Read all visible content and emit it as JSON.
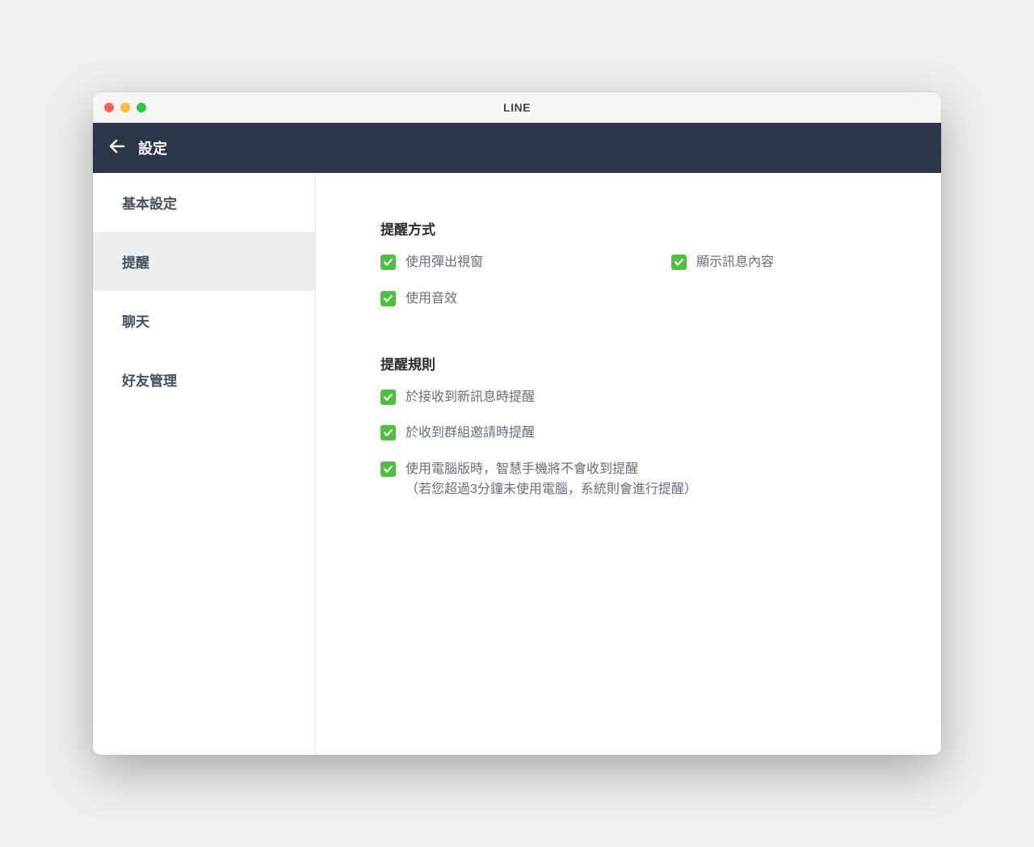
{
  "window": {
    "title": "LINE"
  },
  "header": {
    "title": "設定"
  },
  "sidebar": {
    "items": [
      {
        "label": "基本設定",
        "selected": false
      },
      {
        "label": "提醒",
        "selected": true
      },
      {
        "label": "聊天",
        "selected": false
      },
      {
        "label": "好友管理",
        "selected": false
      }
    ]
  },
  "sections": {
    "notification_method": {
      "title": "提醒方式",
      "options": [
        {
          "label": "使用彈出視窗",
          "checked": true
        },
        {
          "label": "顯示訊息內容",
          "checked": true
        },
        {
          "label": "使用音效",
          "checked": true
        }
      ]
    },
    "notification_rules": {
      "title": "提醒規則",
      "options": [
        {
          "label": "於接收到新訊息時提醒",
          "checked": true
        },
        {
          "label": "於收到群組邀請時提醒",
          "checked": true
        },
        {
          "label": "使用電腦版時，智慧手機將不會收到提醒",
          "sublabel": "（若您超過3分鐘未使用電腦，系統則會進行提醒）",
          "checked": true
        }
      ]
    }
  },
  "colors": {
    "header_bg": "#2c3649",
    "checkbox_green": "#4fbf40",
    "sidebar_selected": "#edeef0"
  }
}
